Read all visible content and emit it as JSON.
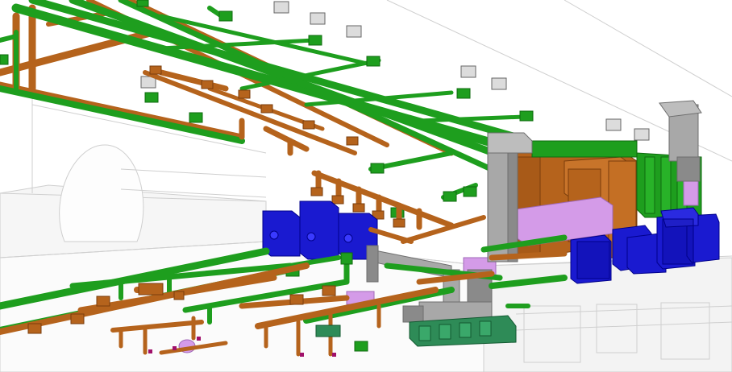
{
  "scene": {
    "kind": "BIM MEP 3D model view",
    "systems": [
      {
        "id": "supply-air",
        "color": "#1e9e1e",
        "shade": "#0f6b0f"
      },
      {
        "id": "return-air",
        "color": "#b5631c",
        "shade": "#7a3d0c"
      },
      {
        "id": "exhaust-duct",
        "color": "#a8a8a8",
        "shade": "#6e6e6e"
      },
      {
        "id": "fan-units",
        "color": "#1a1ad0",
        "shade": "#00008a"
      },
      {
        "id": "heating-coils",
        "color": "#d49be8",
        "shade": "#a069b8"
      },
      {
        "id": "grilles",
        "color": "#2e8b57",
        "shade": "#145a32"
      }
    ],
    "background": {
      "line_color": "#c9c9c9",
      "floor_color": "#f4f4f4"
    }
  }
}
